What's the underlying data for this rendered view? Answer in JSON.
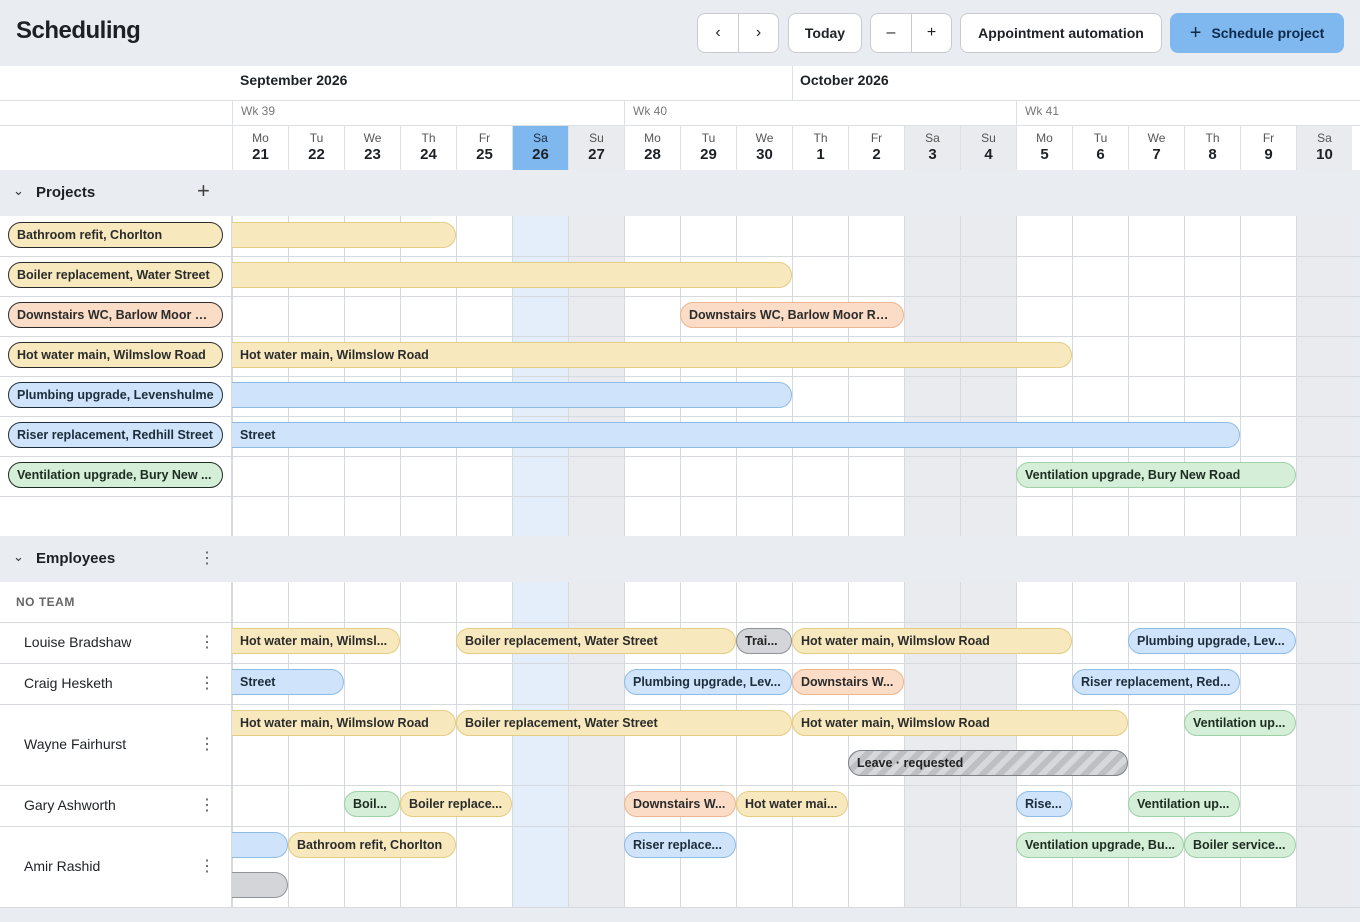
{
  "header": {
    "title": "Scheduling",
    "prev_icon": "chevron-left-icon",
    "next_icon": "chevron-right-icon",
    "today_label": "Today",
    "zoom_out": "–",
    "zoom_in": "+",
    "automation_label": "Appointment automation",
    "schedule_label": "Schedule project",
    "schedule_icon": "plus-icon"
  },
  "calendar": {
    "months": [
      "September 2026",
      "October 2026"
    ],
    "weeks": [
      "Wk 39",
      "Wk 40",
      "Wk 41"
    ],
    "days": [
      {
        "d": "Mo",
        "n": "21"
      },
      {
        "d": "Tu",
        "n": "22"
      },
      {
        "d": "We",
        "n": "23"
      },
      {
        "d": "Th",
        "n": "24"
      },
      {
        "d": "Fr",
        "n": "25"
      },
      {
        "d": "Sa",
        "n": "26"
      },
      {
        "d": "Su",
        "n": "27"
      },
      {
        "d": "Mo",
        "n": "28"
      },
      {
        "d": "Tu",
        "n": "29"
      },
      {
        "d": "We",
        "n": "30"
      },
      {
        "d": "Th",
        "n": "1"
      },
      {
        "d": "Fr",
        "n": "2"
      },
      {
        "d": "Sa",
        "n": "3"
      },
      {
        "d": "Su",
        "n": "4"
      },
      {
        "d": "Mo",
        "n": "5"
      },
      {
        "d": "Tu",
        "n": "6"
      },
      {
        "d": "We",
        "n": "7"
      },
      {
        "d": "Th",
        "n": "8"
      },
      {
        "d": "Fr",
        "n": "9"
      },
      {
        "d": "Sa",
        "n": "10"
      }
    ],
    "today_index": 5,
    "accent_color": "#7fb8ef"
  },
  "projects": {
    "title": "Projects",
    "add_icon": "plus-icon",
    "rows": [
      {
        "label": "Bathroom refit, Chorlton",
        "color": "y",
        "bars": [
          {
            "start": 0,
            "end": 4,
            "text": ""
          }
        ]
      },
      {
        "label": "Boiler replacement, Water Street",
        "color": "y",
        "bars": [
          {
            "start": 0,
            "end": 10,
            "text": ""
          }
        ]
      },
      {
        "label": "Downstairs WC, Barlow Moor R...",
        "color": "o",
        "bars": [
          {
            "start": 8,
            "end": 12,
            "text": "Downstairs WC, Barlow Moor Road"
          }
        ]
      },
      {
        "label": "Hot water main, Wilmslow Road",
        "color": "y",
        "bars": [
          {
            "start": 0,
            "end": 15,
            "text": "Hot water main, Wilmslow Road"
          }
        ]
      },
      {
        "label": "Plumbing upgrade, Levenshulme",
        "color": "b",
        "bars": [
          {
            "start": 0,
            "end": 10,
            "text": ""
          }
        ]
      },
      {
        "label": "Riser replacement, Redhill Street",
        "color": "b",
        "bars": [
          {
            "start": 0,
            "end": 18,
            "text": "Street"
          }
        ]
      },
      {
        "label": "Ventilation upgrade, Bury New ...",
        "color": "g",
        "bars": [
          {
            "start": 14,
            "end": 19,
            "text": "Ventilation upgrade, Bury New Road"
          }
        ]
      }
    ]
  },
  "employees": {
    "title": "Employees",
    "team_label": "NO TEAM",
    "rows": [
      {
        "name": "Louise Bradshaw",
        "lanes": [
          [
            {
              "start": 0,
              "end": 3,
              "c": "y",
              "text": "Hot water main, Wilmsl..."
            },
            {
              "start": 4,
              "end": 9,
              "c": "y",
              "text": "Boiler replacement, Water Street"
            },
            {
              "start": 9,
              "end": 10,
              "c": "gr",
              "text": "Trai..."
            },
            {
              "start": 10,
              "end": 15,
              "c": "y",
              "text": "Hot water main, Wilmslow Road"
            },
            {
              "start": 16,
              "end": 19,
              "c": "b",
              "text": "Plumbing upgrade, Lev..."
            }
          ]
        ]
      },
      {
        "name": "Craig Hesketh",
        "lanes": [
          [
            {
              "start": 0,
              "end": 2,
              "c": "b",
              "text": "Street"
            },
            {
              "start": 7,
              "end": 10,
              "c": "b",
              "text": "Plumbing upgrade, Lev..."
            },
            {
              "start": 10,
              "end": 12,
              "c": "o",
              "text": "Downstairs W..."
            },
            {
              "start": 15,
              "end": 18,
              "c": "b",
              "text": "Riser replacement, Red..."
            }
          ]
        ]
      },
      {
        "name": "Wayne Fairhurst",
        "lanes": [
          [
            {
              "start": 0,
              "end": 4,
              "c": "y",
              "text": "Hot water main, Wilmslow Road"
            },
            {
              "start": 4,
              "end": 10,
              "c": "y",
              "text": "Boiler replacement, Water Street"
            },
            {
              "start": 10,
              "end": 16,
              "c": "y",
              "text": "Hot water main, Wilmslow Road"
            },
            {
              "start": 17,
              "end": 19,
              "c": "g",
              "text": "Ventilation up..."
            }
          ],
          [
            {
              "start": 11,
              "end": 16,
              "c": "hatch",
              "text": "Leave · requested"
            }
          ]
        ]
      },
      {
        "name": "Gary Ashworth",
        "lanes": [
          [
            {
              "start": 2,
              "end": 3,
              "c": "g",
              "text": "Boil..."
            },
            {
              "start": 3,
              "end": 5,
              "c": "y",
              "text": "Boiler replace..."
            },
            {
              "start": 7,
              "end": 9,
              "c": "o",
              "text": "Downstairs W..."
            },
            {
              "start": 9,
              "end": 11,
              "c": "y",
              "text": "Hot water mai..."
            },
            {
              "start": 14,
              "end": 15,
              "c": "b",
              "text": "Rise..."
            },
            {
              "start": 16,
              "end": 18,
              "c": "g",
              "text": "Ventilation up..."
            }
          ]
        ]
      },
      {
        "name": "Amir Rashid",
        "lanes": [
          [
            {
              "start": 0,
              "end": 1,
              "c": "b",
              "text": ""
            },
            {
              "start": 1,
              "end": 4,
              "c": "y",
              "text": "Bathroom refit, Chorlton"
            },
            {
              "start": 7,
              "end": 9,
              "c": "b",
              "text": "Riser replace..."
            },
            {
              "start": 14,
              "end": 17,
              "c": "g",
              "text": "Ventilation upgrade, Bu..."
            },
            {
              "start": 17,
              "end": 19,
              "c": "g",
              "text": "Boiler service..."
            }
          ],
          [
            {
              "start": 0,
              "end": 1,
              "c": "gr",
              "text": ""
            }
          ]
        ]
      }
    ]
  }
}
